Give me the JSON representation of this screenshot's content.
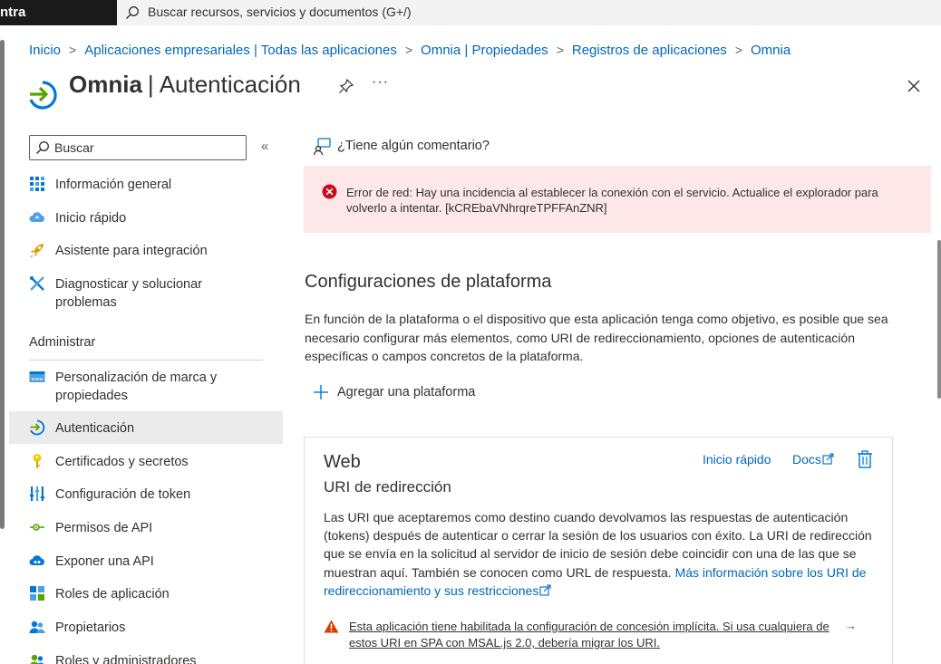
{
  "topbar": {
    "brand": "ntra",
    "search_placeholder": "Buscar recursos, servicios y documentos (G+/)"
  },
  "breadcrumb": [
    "Inicio",
    "Aplicaciones empresariales | Todas las aplicaciones",
    "Omnia | Propiedades",
    "Registros de aplicaciones",
    "Omnia"
  ],
  "header": {
    "app_name": "Omnia",
    "separator": "|",
    "page_name": "Autenticación",
    "more": "···"
  },
  "sidebar": {
    "search_placeholder": "Buscar",
    "collapse": "«",
    "items": [
      {
        "label": "Información general",
        "icon": "grid-icon"
      },
      {
        "label": "Inicio rápido",
        "icon": "cloud-icon"
      },
      {
        "label": "Asistente para integración",
        "icon": "rocket-icon"
      },
      {
        "label": "Diagnosticar y solucionar problemas",
        "icon": "wrench-icon"
      }
    ],
    "section_title": "Administrar",
    "manage_items": [
      {
        "label": "Personalización de marca y propiedades",
        "icon": "www-icon"
      },
      {
        "label": "Autenticación",
        "icon": "auth-arrow-icon",
        "active": true
      },
      {
        "label": "Certificados y secretos",
        "icon": "key-icon"
      },
      {
        "label": "Configuración de token",
        "icon": "token-bars-icon"
      },
      {
        "label": "Permisos de API",
        "icon": "api-permission-icon"
      },
      {
        "label": "Exponer una API",
        "icon": "cloud-api-icon"
      },
      {
        "label": "Roles de aplicación",
        "icon": "roles-grid-icon"
      },
      {
        "label": "Propietarios",
        "icon": "people-icon"
      },
      {
        "label": "Roles y administradores",
        "icon": "admin-people-icon"
      }
    ]
  },
  "main": {
    "feedback": "¿Tiene algún comentario?",
    "error_message": "Error de red: Hay una incidencia al establecer la conexión con el servicio. Actualice el explorador para volverlo a intentar. [kCREbaVNhrqreTPFFAnZNR]",
    "platform_title": "Configuraciones de plataforma",
    "platform_desc": "En función de la plataforma o el dispositivo que esta aplicación tenga como objetivo, es posible que sea necesario configurar más elementos, como URI de redireccionamiento, opciones de autenticación específicas o campos concretos de la plataforma.",
    "add_platform": "Agregar una plataforma",
    "card": {
      "title": "Web",
      "subtitle": "URI de redirección",
      "quickstart": "Inicio rápido",
      "docs": "Docs",
      "text": "Las URI que aceptaremos como destino cuando devolvamos las respuestas de autenticación (tokens) después de autenticar o cerrar la sesión de los usuarios con éxito. La URI de redirección que se envía en la solicitud al servidor de inicio de sesión debe coincidir con una de las que se muestran aquí. También se conocen como URL de respuesta.",
      "link": "Más información sobre los URI de redireccionamiento y sus restricciones",
      "warning": "Esta aplicación tiene habilitada la configuración de concesión implícita. Si usa cualquiera de estos URI en SPA con MSAL.js 2.0, debería migrar los URI.",
      "warning_arrow": "→"
    }
  },
  "colors": {
    "link": "#0067b8",
    "error_bg": "#fde7e9",
    "error_icon": "#c50f1f",
    "warning_icon": "#d83b01",
    "active_bg": "#ebebeb",
    "topbar_bg": "#1b1b1b"
  }
}
